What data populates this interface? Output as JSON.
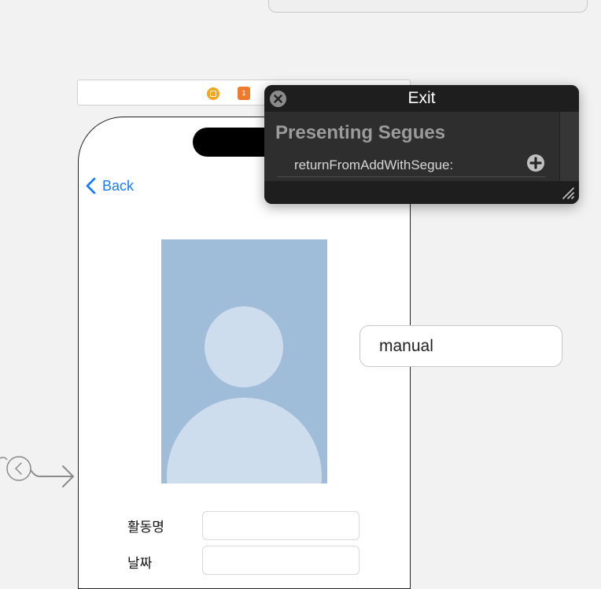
{
  "view_controller": {
    "back_label": "Back",
    "field_labels": [
      "활동명",
      "날짜"
    ]
  },
  "dock": {
    "exit_badge": "1"
  },
  "exit_popover": {
    "title": "Exit",
    "section_title": "Presenting Segues",
    "segues": [
      "returnFromAddWithSegue:"
    ]
  },
  "segue_trigger": {
    "label": "manual"
  },
  "colors": {
    "accent": "#1b7cf5",
    "placeholder_image": "#9fbcd9",
    "dock_orange": "#ee7a2c"
  }
}
